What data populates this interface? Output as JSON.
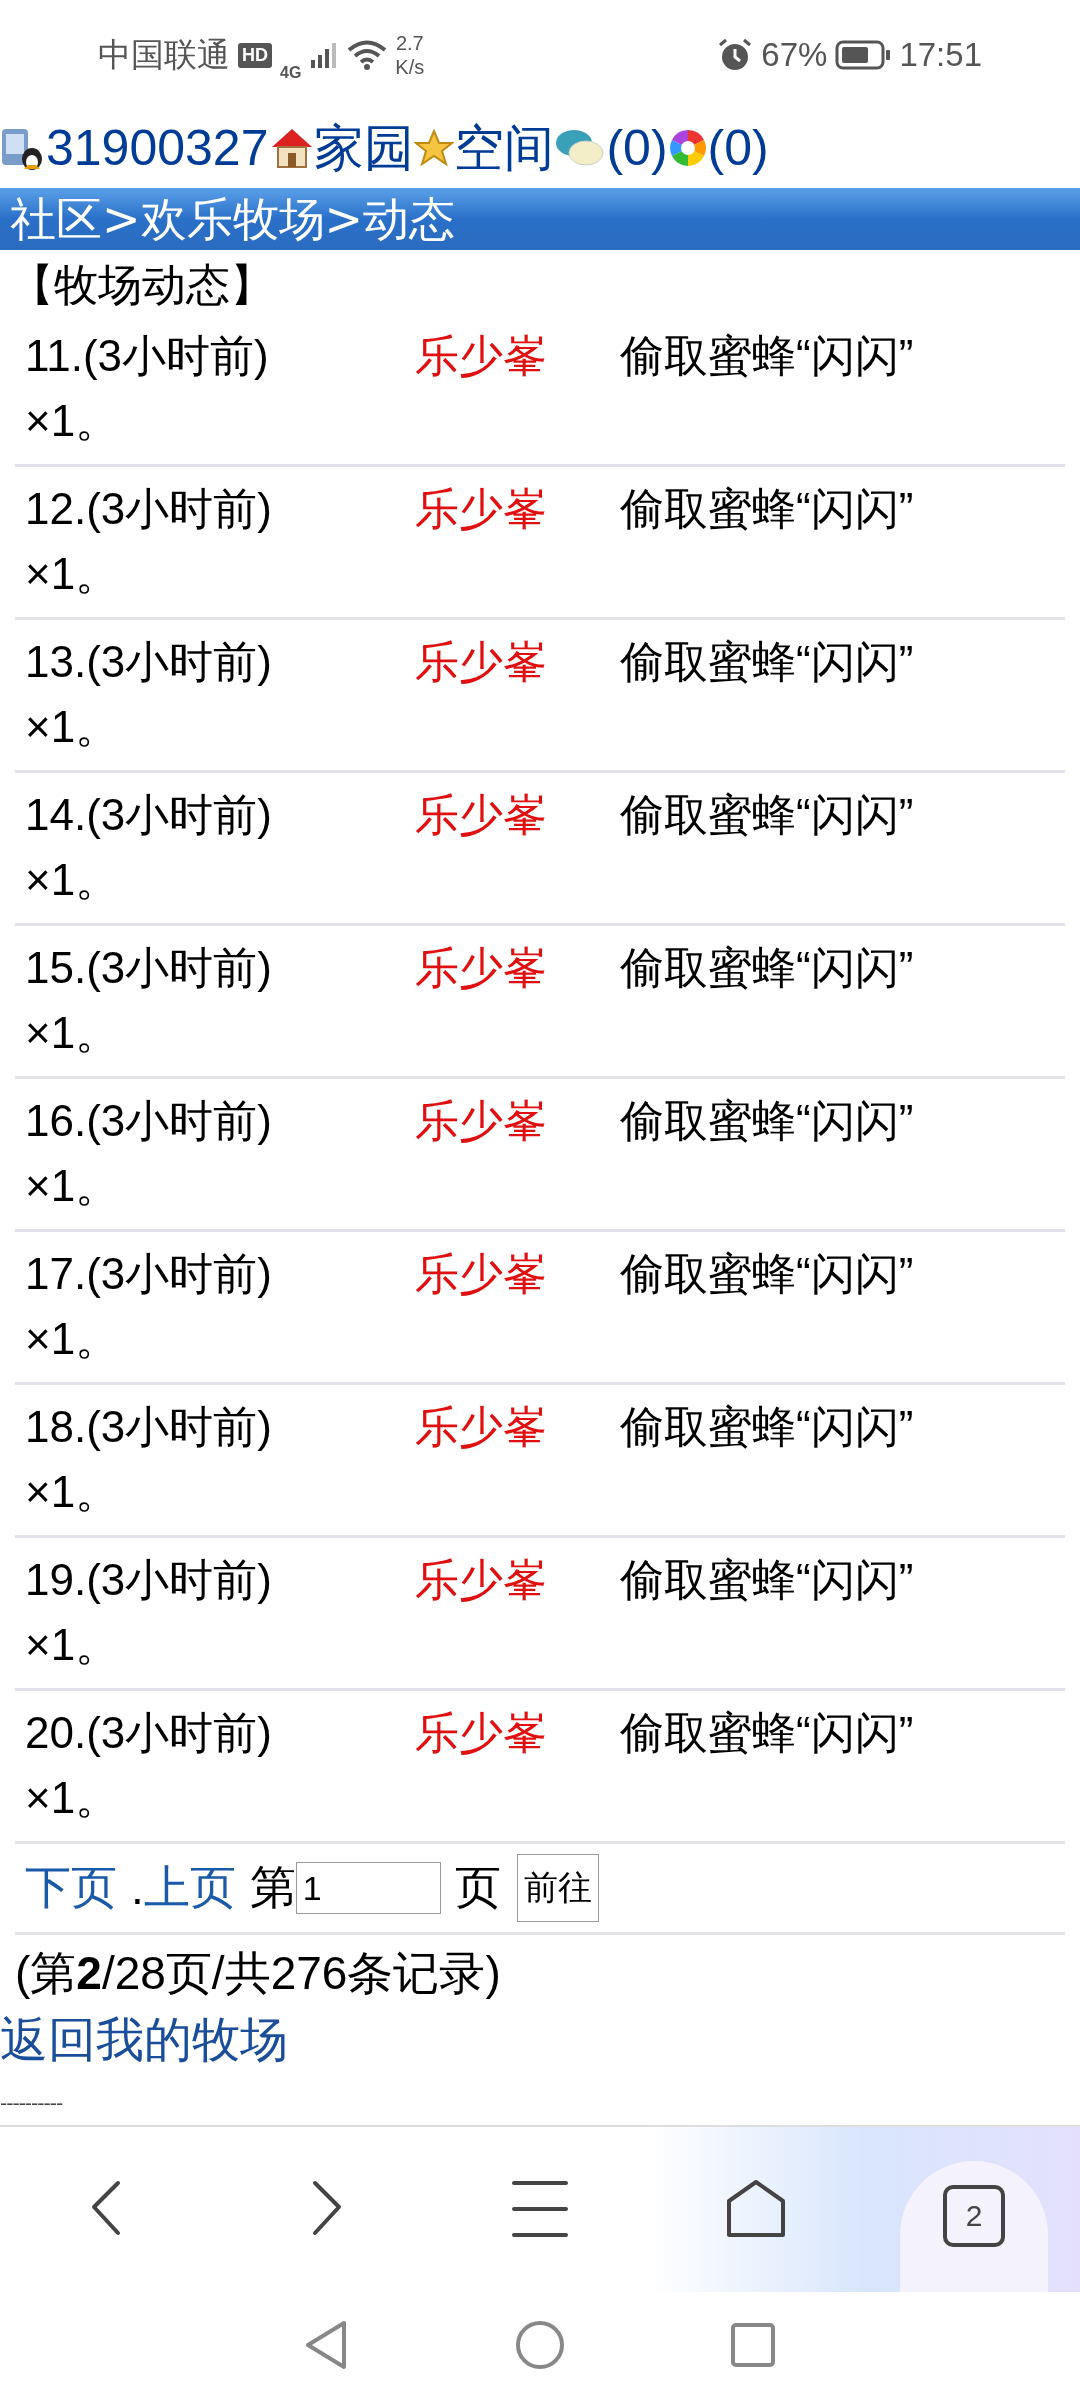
{
  "status_bar": {
    "carrier": "中国联通",
    "hd": "HD",
    "network": "4G",
    "speed_value": "2.7",
    "speed_unit": "K/s",
    "battery": "67%",
    "time": "17:51"
  },
  "header": {
    "user_id": "31900327",
    "home": "家园",
    "space": "空间",
    "messages": "(0)",
    "photos": "(0)"
  },
  "breadcrumb": "社区>欢乐牧场>动态",
  "section_title": "【牧场动态】",
  "events": [
    {
      "index": "11.(3小时前)",
      "name": "乐少峯",
      "action": "偷取蜜蜂“闪闪”",
      "count": "×1。"
    },
    {
      "index": "12.(3小时前)",
      "name": "乐少峯",
      "action": "偷取蜜蜂“闪闪”",
      "count": "×1。"
    },
    {
      "index": "13.(3小时前)",
      "name": "乐少峯",
      "action": "偷取蜜蜂“闪闪”",
      "count": "×1。"
    },
    {
      "index": "14.(3小时前)",
      "name": "乐少峯",
      "action": "偷取蜜蜂“闪闪”",
      "count": "×1。"
    },
    {
      "index": "15.(3小时前)",
      "name": "乐少峯",
      "action": "偷取蜜蜂“闪闪”",
      "count": "×1。"
    },
    {
      "index": "16.(3小时前)",
      "name": "乐少峯",
      "action": "偷取蜜蜂“闪闪”",
      "count": "×1。"
    },
    {
      "index": "17.(3小时前)",
      "name": "乐少峯",
      "action": "偷取蜜蜂“闪闪”",
      "count": "×1。"
    },
    {
      "index": "18.(3小时前)",
      "name": "乐少峯",
      "action": "偷取蜜蜂“闪闪”",
      "count": "×1。"
    },
    {
      "index": "19.(3小时前)",
      "name": "乐少峯",
      "action": "偷取蜜蜂“闪闪”",
      "count": "×1。"
    },
    {
      "index": "20.(3小时前)",
      "name": "乐少峯",
      "action": "偷取蜜蜂“闪闪”",
      "count": "×1。"
    }
  ],
  "pagination": {
    "next": "下页",
    "separator": ".",
    "prev": "上页",
    "page_prefix": "第",
    "page_value": "1",
    "page_suffix": "页",
    "go_button": "前往",
    "summary": "(第**2**/28页/共276条记录)"
  },
  "back_link": "返回我的牧场",
  "divider_text": "----------",
  "browser_bar": {
    "tab_count": "2"
  }
}
